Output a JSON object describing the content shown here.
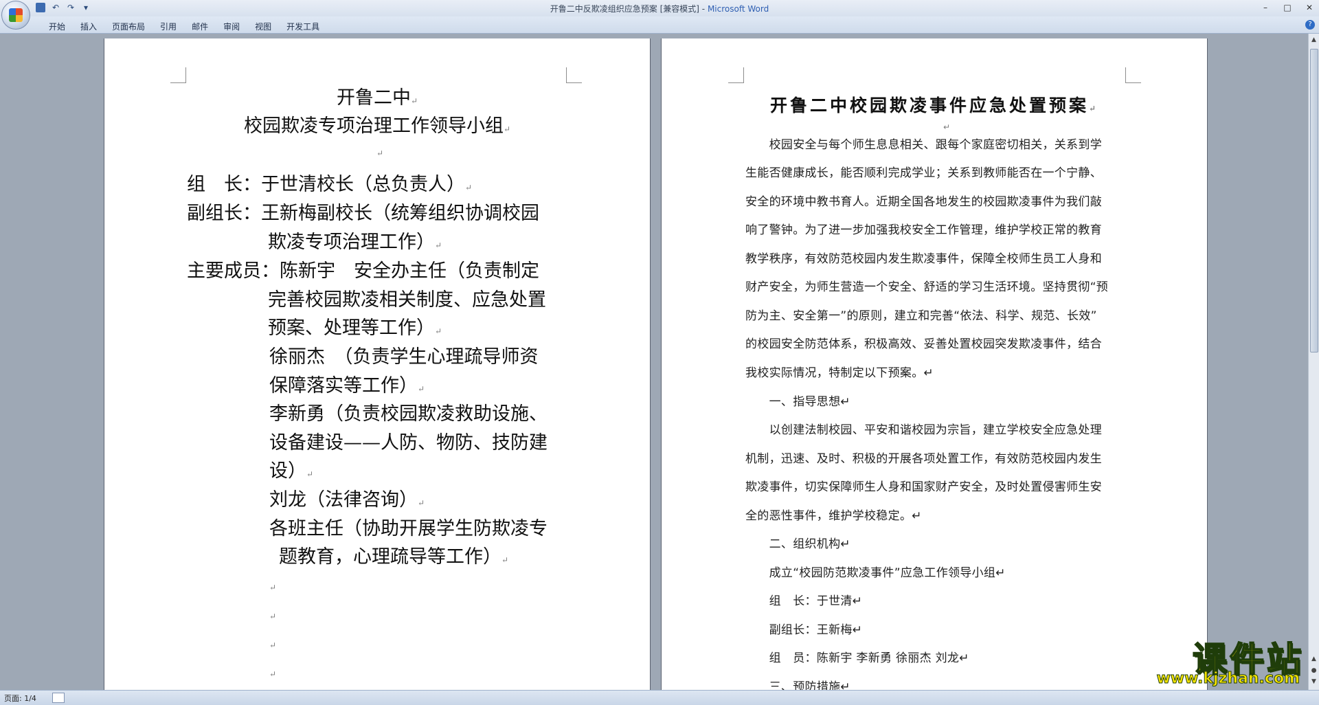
{
  "window": {
    "title_doc": "开鲁二中反欺凌组织应急预案 [兼容模式]",
    "title_sep": " - ",
    "title_app": "Microsoft Word"
  },
  "ribbon": {
    "tabs": [
      "开始",
      "插入",
      "页面布局",
      "引用",
      "邮件",
      "审阅",
      "视图",
      "开发工具"
    ]
  },
  "left_page": {
    "title1": "开鲁二中",
    "title2": "校园欺凌专项治理工作领导小组",
    "leader": "组　长：于世清校长（总负责人）",
    "vice_1": "副组长：王新梅副校长（统筹组织协调校园",
    "vice_2": "欺凌专项治理工作）",
    "member_1": "主要成员：陈新宇　安全办主任（负责制定",
    "member_2": "完善校园欺凌相关制度、应急处置",
    "member_3": "预案、处理等工作）",
    "member_4": "徐丽杰　（负责学生心理疏导师资",
    "member_5": "保障落实等工作）",
    "member_6": "李新勇（负责校园欺凌救助设施、",
    "member_7": "设备建设——人防、物防、技防建",
    "member_8": "设）",
    "member_9": "刘龙（法律咨询）",
    "member_10": "各班主任（协助开展学生防欺凌专",
    "member_11": "题教育，心理疏导等工作）",
    "para_mark": "↵"
  },
  "right_page": {
    "title": "开鲁二中校园欺凌事件应急处置预案",
    "lines": [
      "　　校园安全与每个师生息息相关、跟每个家庭密切相关，关系到学",
      "生能否健康成长，能否顺利完成学业；关系到教师能否在一个宁静、",
      "安全的环境中教书育人。近期全国各地发生的校园欺凌事件为我们敲",
      "响了警钟。为了进一步加强我校安全工作管理，维护学校正常的教育",
      "教学秩序，有效防范校园内发生欺凌事件，保障全校师生员工人身和",
      "财产安全，为师生营造一个安全、舒适的学习生活环境。坚持贯彻“预",
      "防为主、安全第一”的原则，建立和完善“依法、科学、规范、长效”",
      "的校园安全防范体系，积极高效、妥善处置校园突发欺凌事件，结合",
      "我校实际情况，特制定以下预案。↵",
      "　　一、指导思想↵",
      "　　以创建法制校园、平安和谐校园为宗旨，建立学校安全应急处理",
      "机制，迅速、及时、积极的开展各项处置工作，有效防范校园内发生",
      "欺凌事件，切实保障师生人身和国家财产安全，及时处置侵害师生安",
      "全的恶性事件，维护学校稳定。↵",
      "　　二、组织机构↵",
      "　　成立“校园防范欺凌事件”应急工作领导小组↵",
      "　　组　长：于世清↵",
      "　　副组长：王新梅↵",
      "　　组　员：陈新宇  李新勇  徐丽杰  刘龙↵",
      "　　三、预防措施↵"
    ]
  },
  "status": {
    "page_info": "页面: 1/4"
  },
  "watermark": {
    "main": "课件站",
    "url": "www.kjzhan.com"
  }
}
